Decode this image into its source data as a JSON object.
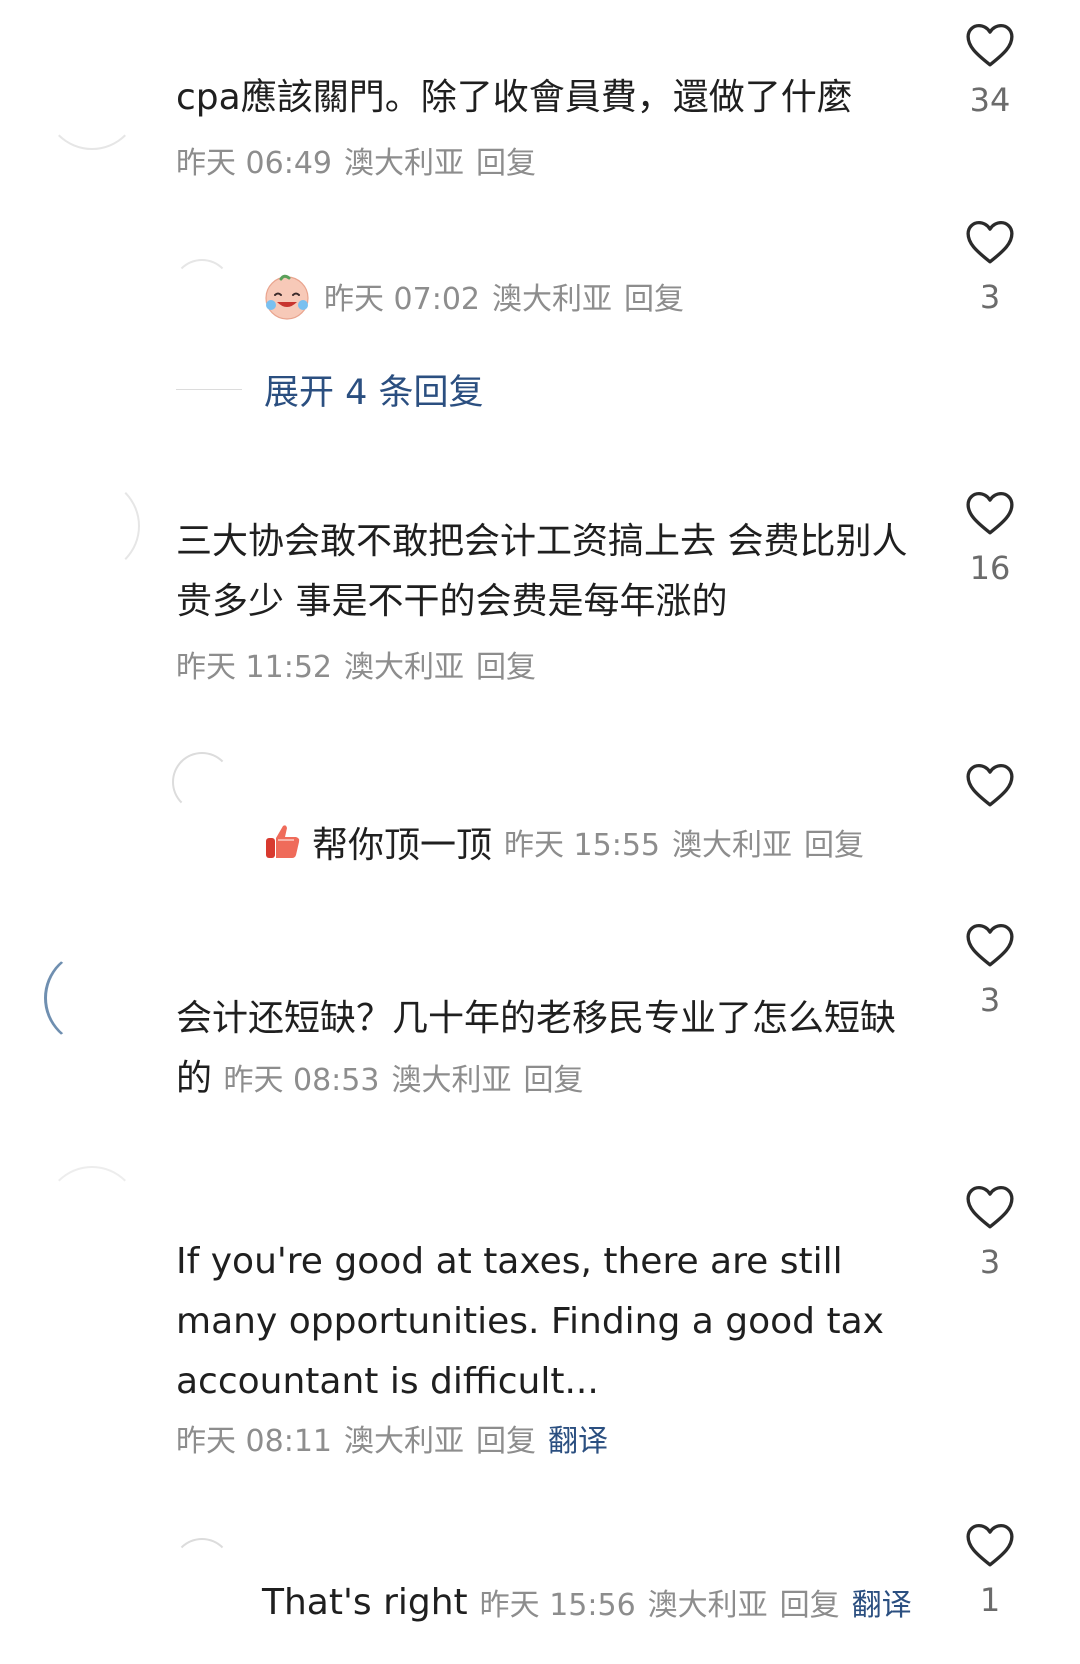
{
  "comments": [
    {
      "text": "cpa應該關門。除了收會員費，還做了什麼",
      "time": "昨天 06:49",
      "location": "澳大利亚",
      "reply_label": "回复",
      "likes": "34"
    },
    {
      "text": "三大协会敢不敢把会计工资搞上去 会费比别人贵多少 事是不干的会费是每年涨的",
      "time": "昨天 11:52",
      "location": "澳大利亚",
      "reply_label": "回复",
      "likes": "16"
    },
    {
      "text": "会计还短缺？几十年的老移民专业了怎么短缺的",
      "time": "昨天 08:53",
      "location": "澳大利亚",
      "reply_label": "回复",
      "likes": "3"
    },
    {
      "text": "If you're good at taxes, there are still many opportunities. Finding a good tax accountant is difficult...",
      "time": "昨天 08:11",
      "location": "澳大利亚",
      "reply_label": "回复",
      "translate_label": "翻译",
      "likes": "3"
    }
  ],
  "replies": [
    {
      "emoji": "crying-laughing-emoji",
      "time": "昨天 07:02",
      "location": "澳大利亚",
      "reply_label": "回复",
      "likes": "3"
    },
    {
      "emoji": "thumbs-up-emoji",
      "text": "帮你顶一顶",
      "time": "昨天 15:55",
      "location": "澳大利亚",
      "reply_label": "回复",
      "likes": ""
    },
    {
      "text": "That's right",
      "time": "昨天 15:56",
      "location": "澳大利亚",
      "reply_label": "回复",
      "translate_label": "翻译",
      "likes": "1"
    }
  ],
  "expand": {
    "label": "展开 4 条回复"
  },
  "colors": {
    "text": "#1f1f1f",
    "meta": "#8d8d8d",
    "link": "#2b4f80",
    "heart_stroke": "#2b2b2b"
  },
  "icons": {
    "like": "heart-outline-icon"
  }
}
